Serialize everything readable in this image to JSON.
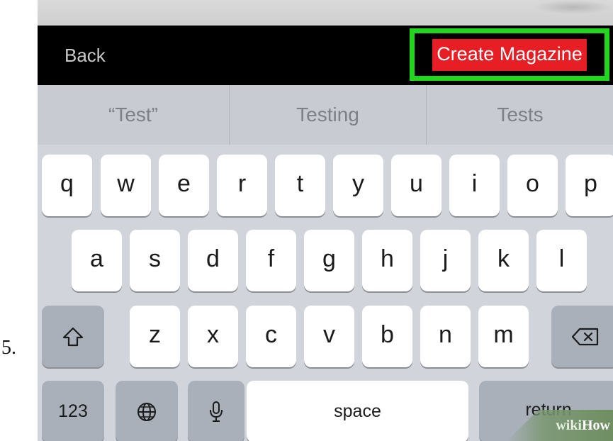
{
  "step": {
    "number": "5."
  },
  "topbar": {
    "back_label": "Back",
    "create_label": "Create Magazine"
  },
  "suggestions": [
    "“Test”",
    "Testing",
    "Tests"
  ],
  "keyboard": {
    "row1": [
      "q",
      "w",
      "e",
      "r",
      "t",
      "y",
      "u",
      "i",
      "o",
      "p"
    ],
    "row2": [
      "a",
      "s",
      "d",
      "f",
      "g",
      "h",
      "j",
      "k",
      "l"
    ],
    "row3": [
      "z",
      "x",
      "c",
      "v",
      "b",
      "n",
      "m"
    ],
    "numbers_label": "123",
    "space_label": "space",
    "return_label": "return",
    "icons": {
      "shift": "shift-icon",
      "delete": "delete-icon",
      "globe": "globe-icon",
      "mic": "microphone-icon"
    }
  },
  "watermark": {
    "part1": "wiki",
    "part2": "How"
  },
  "colors": {
    "highlight": "#22d61e",
    "create_bg": "#e81e25",
    "bar_bg": "#000000",
    "keyboard_bg": "#d1d5db"
  }
}
